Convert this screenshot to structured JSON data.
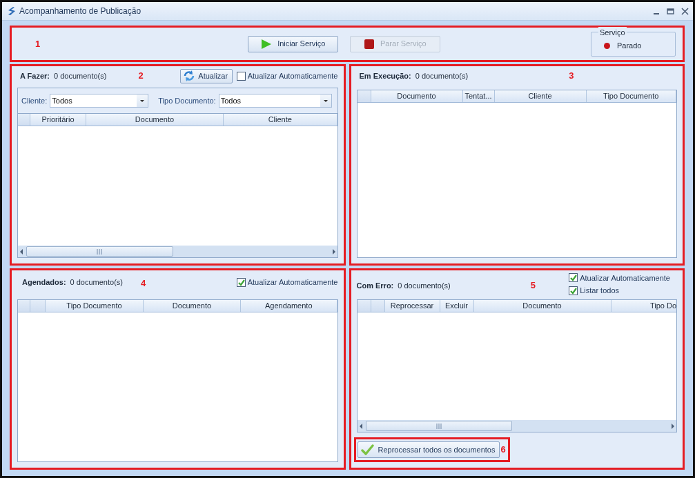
{
  "window": {
    "title": "Acompanhamento de Publicação"
  },
  "service_bar": {
    "annotation": "1",
    "buttons": [
      {
        "label": "Iniciar Serviço",
        "kind": "start",
        "disabled": false
      },
      {
        "label": "Parar Serviço",
        "kind": "stop",
        "disabled": true
      }
    ],
    "status_group": {
      "title": "Serviço",
      "status": "Parado",
      "running": false
    }
  },
  "panels": [
    {
      "kind": "todo",
      "annotation": "2",
      "title": "A Fazer:",
      "count": "0 documento(s)",
      "refresh_button": "Atualizar",
      "checkboxes": [
        {
          "label": "Atualizar Automaticamente",
          "checked": false
        }
      ],
      "filters": [
        {
          "label": "Cliente:",
          "value": "Todos"
        },
        {
          "label": "Tipo Documento:",
          "value": "Todos"
        }
      ],
      "columns": [
        {
          "kind": "blank"
        },
        {
          "label": "Prioritário"
        },
        {
          "label": "Documento"
        },
        {
          "label": "Cliente"
        }
      ],
      "horizontal_scrollbar": true
    },
    {
      "kind": "running",
      "annotation": "3",
      "title": "Em Execução:",
      "count": "0 documento(s)",
      "columns": [
        {
          "kind": "blank"
        },
        {
          "label": "Documento"
        },
        {
          "label": "Tentat..."
        },
        {
          "label": "Cliente"
        },
        {
          "label": "Tipo Documento"
        }
      ],
      "horizontal_scrollbar": false
    },
    {
      "kind": "scheduled",
      "annotation": "4",
      "title": "Agendados:",
      "count": "0 documento(s)",
      "checkboxes": [
        {
          "label": "Atualizar Automaticamente",
          "checked": true
        }
      ],
      "columns": [
        {
          "kind": "blank"
        },
        {
          "kind": "blank"
        },
        {
          "label": "Tipo Documento"
        },
        {
          "label": "Documento"
        },
        {
          "label": "Agendamento"
        }
      ],
      "horizontal_scrollbar": false
    },
    {
      "kind": "error",
      "annotation": "5",
      "title": "Com Erro:",
      "count": "0 documento(s)",
      "checkboxes": [
        {
          "label": "Atualizar Automaticamente",
          "checked": true
        },
        {
          "label": "Listar todos",
          "checked": true
        }
      ],
      "columns": [
        {
          "kind": "blank"
        },
        {
          "kind": "blank"
        },
        {
          "label": "Reprocessar"
        },
        {
          "label": "Excluir"
        },
        {
          "label": "Documento"
        },
        {
          "label": "Tipo Do"
        }
      ],
      "horizontal_scrollbar": true,
      "bulk_button": {
        "label": "Reprocessar todos os documentos",
        "annotation": "6"
      }
    }
  ]
}
